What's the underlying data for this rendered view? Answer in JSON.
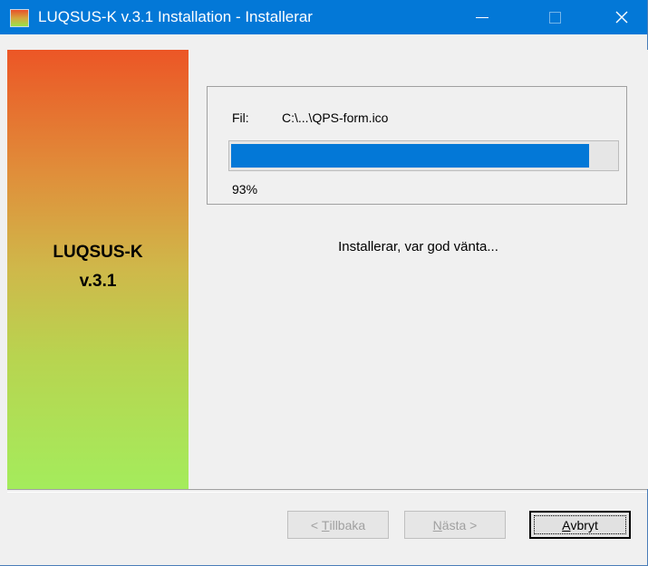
{
  "window": {
    "title": "LUQSUS-K v.3.1 Installation - Installerar",
    "controls": {
      "minimize": "—",
      "close": "✕"
    }
  },
  "sidebar": {
    "product_line1": "LUQSUS-K",
    "product_line2": "v.3.1"
  },
  "progress": {
    "file_label": "Fil:",
    "file_value": "C:\\...\\QPS-form.ico",
    "percent_text": "93%",
    "percent_value": 0.93
  },
  "status": {
    "text": "Installerar, var god vänta..."
  },
  "buttons": {
    "back": {
      "pre": "< ",
      "accel": "T",
      "post": "illbaka"
    },
    "next": {
      "pre": "",
      "accel": "N",
      "post": "ästa >"
    },
    "cancel": {
      "pre": "",
      "accel": "A",
      "post": "vbryt"
    }
  },
  "colors": {
    "titlebar": "#0378d7",
    "progress_fill": "#0378d7",
    "sidebar_top": "#ec5626",
    "sidebar_bottom": "#a4ec5c"
  }
}
